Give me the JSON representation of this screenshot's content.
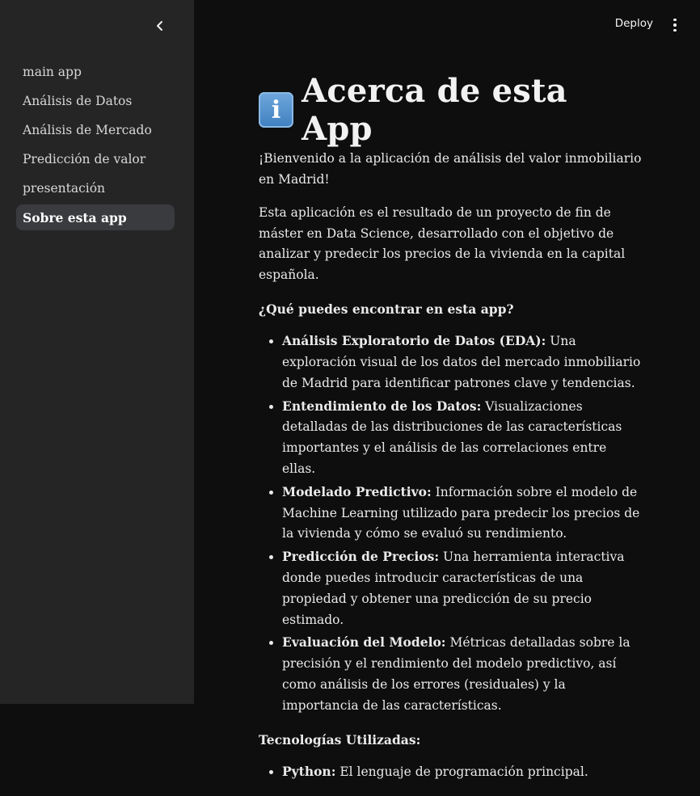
{
  "sidebar": {
    "items": [
      {
        "label": "main app",
        "active": false
      },
      {
        "label": "Análisis de Datos",
        "active": false
      },
      {
        "label": "Análisis de Mercado",
        "active": false
      },
      {
        "label": "Predicción de valor",
        "active": false
      },
      {
        "label": "presentación",
        "active": false
      },
      {
        "label": "Sobre esta app",
        "active": true
      }
    ]
  },
  "header": {
    "deploy_label": "Deploy"
  },
  "main": {
    "title_icon": "info-icon",
    "title": "Acerca de esta App",
    "intro": "¡Bienvenido a la aplicación de análisis del valor inmobiliario en Madrid!",
    "description": "Esta aplicación es el resultado de un proyecto de fin de máster en Data Science, desarrollado con el objetivo de analizar y predecir los precios de la vivienda en la capital española.",
    "features_heading": "¿Qué puedes encontrar en esta app?",
    "features": [
      {
        "title": "Análisis Exploratorio de Datos (EDA):",
        "text": " Una exploración visual de los datos del mercado inmobiliario de Madrid para identificar patrones clave y tendencias."
      },
      {
        "title": "Entendimiento de los Datos:",
        "text": " Visualizaciones detalladas de las distribuciones de las características importantes y el análisis de las correlaciones entre ellas."
      },
      {
        "title": "Modelado Predictivo:",
        "text": " Información sobre el modelo de Machine Learning utilizado para predecir los precios de la vivienda y cómo se evaluó su rendimiento."
      },
      {
        "title": "Predicción de Precios:",
        "text": " Una herramienta interactiva donde puedes introducir características de una propiedad y obtener una predicción de su precio estimado."
      },
      {
        "title": "Evaluación del Modelo:",
        "text": " Métricas detalladas sobre la precisión y el rendimiento del modelo predictivo, así como análisis de los errores (residuales) y la importancia de las características."
      }
    ],
    "tech_heading": "Tecnologías Utilizadas:",
    "tech": [
      {
        "title": "Python:",
        "text": " El lenguaje de programación principal."
      }
    ]
  },
  "colors": {
    "sidebar_bg": "#252526",
    "main_bg": "#0e0e0e",
    "active_item_bg": "#3a3b3f"
  }
}
